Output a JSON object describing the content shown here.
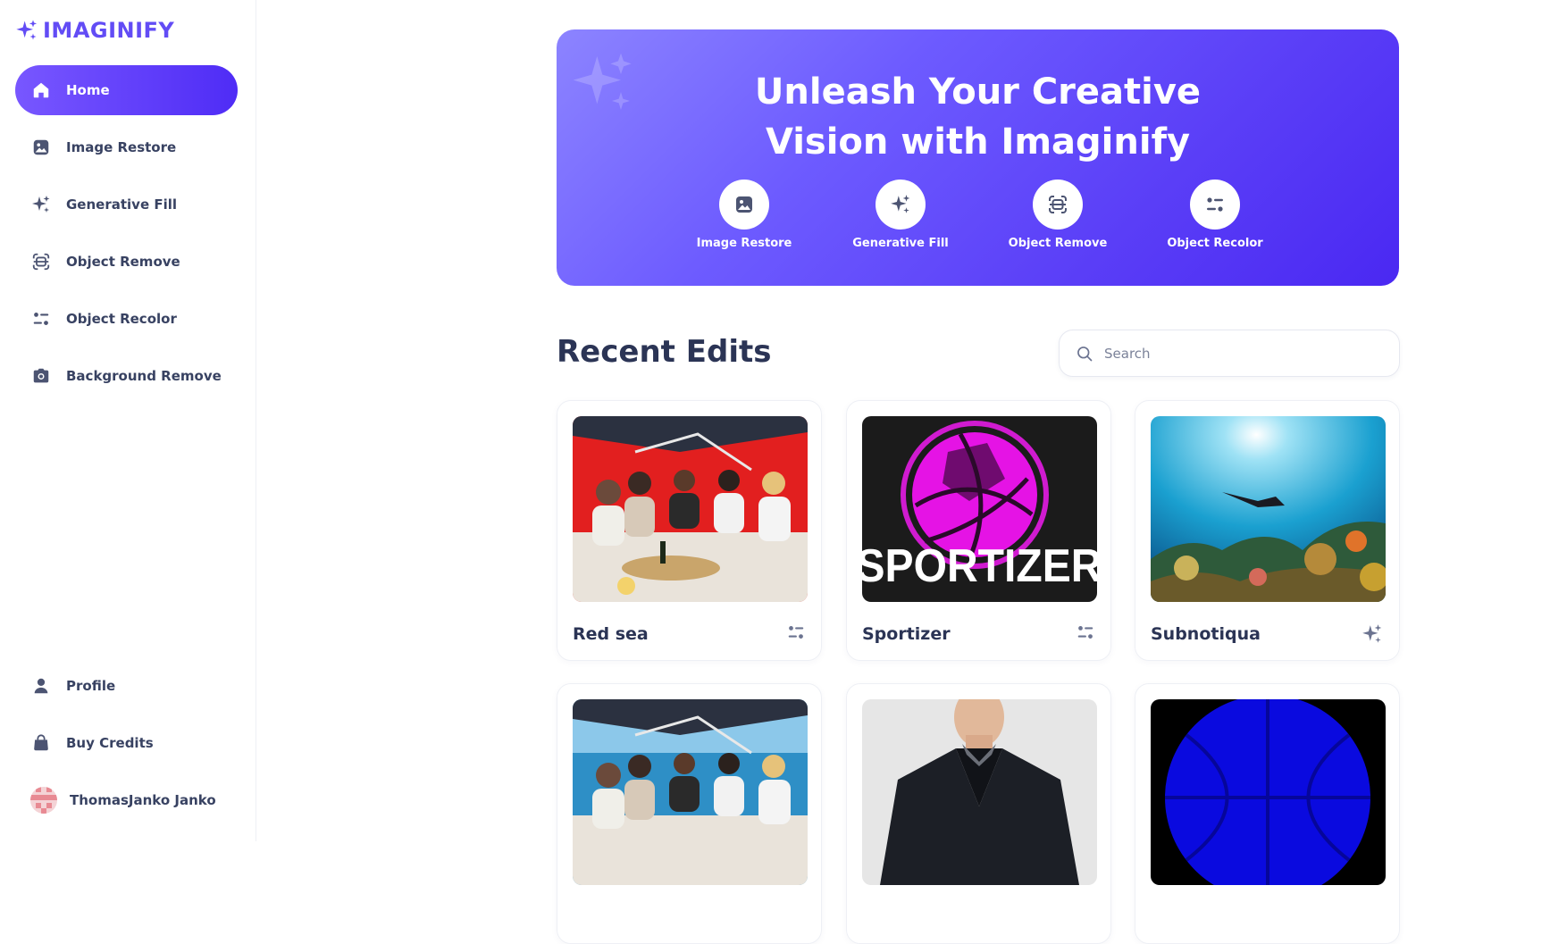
{
  "brand": {
    "name": "IMAGINIFY",
    "color": "#624cf5"
  },
  "sidebar": {
    "items": [
      {
        "label": "Home",
        "icon": "home-icon",
        "active": true
      },
      {
        "label": "Image Restore",
        "icon": "image-icon",
        "active": false
      },
      {
        "label": "Generative Fill",
        "icon": "stars-icon",
        "active": false
      },
      {
        "label": "Object Remove",
        "icon": "scan-icon",
        "active": false
      },
      {
        "label": "Object Recolor",
        "icon": "filter-icon",
        "active": false
      },
      {
        "label": "Background Remove",
        "icon": "camera-icon",
        "active": false
      }
    ],
    "bottom": [
      {
        "label": "Profile",
        "icon": "profile-icon"
      },
      {
        "label": "Buy Credits",
        "icon": "bag-icon"
      }
    ],
    "user": {
      "name": "ThomasJanko Janko"
    }
  },
  "banner": {
    "title_line1": "Unleash Your Creative",
    "title_line2": "Vision with Imaginify",
    "links": [
      {
        "label": "Image Restore",
        "icon": "image-icon"
      },
      {
        "label": "Generative Fill",
        "icon": "stars-icon"
      },
      {
        "label": "Object Remove",
        "icon": "scan-icon"
      },
      {
        "label": "Object Recolor",
        "icon": "filter-icon"
      }
    ]
  },
  "recent": {
    "title": "Recent Edits",
    "search_placeholder": "Search",
    "cards": [
      {
        "title": "Red sea",
        "type_icon": "filter-icon",
        "thumb": "boat-party-red"
      },
      {
        "title": "Sportizer",
        "type_icon": "filter-icon",
        "thumb": "sportizer-logo",
        "logo_text": "SPORTIZER"
      },
      {
        "title": "Subnotiqua",
        "type_icon": "stars-icon",
        "thumb": "underwater-diver"
      },
      {
        "title": "",
        "type_icon": "",
        "thumb": "boat-party-blue"
      },
      {
        "title": "",
        "type_icon": "",
        "thumb": "man-in-jacket"
      },
      {
        "title": "",
        "type_icon": "",
        "thumb": "blue-ball"
      }
    ]
  },
  "colors": {
    "accent": "#624cf5",
    "text": "#384262",
    "heading": "#2b3455"
  }
}
